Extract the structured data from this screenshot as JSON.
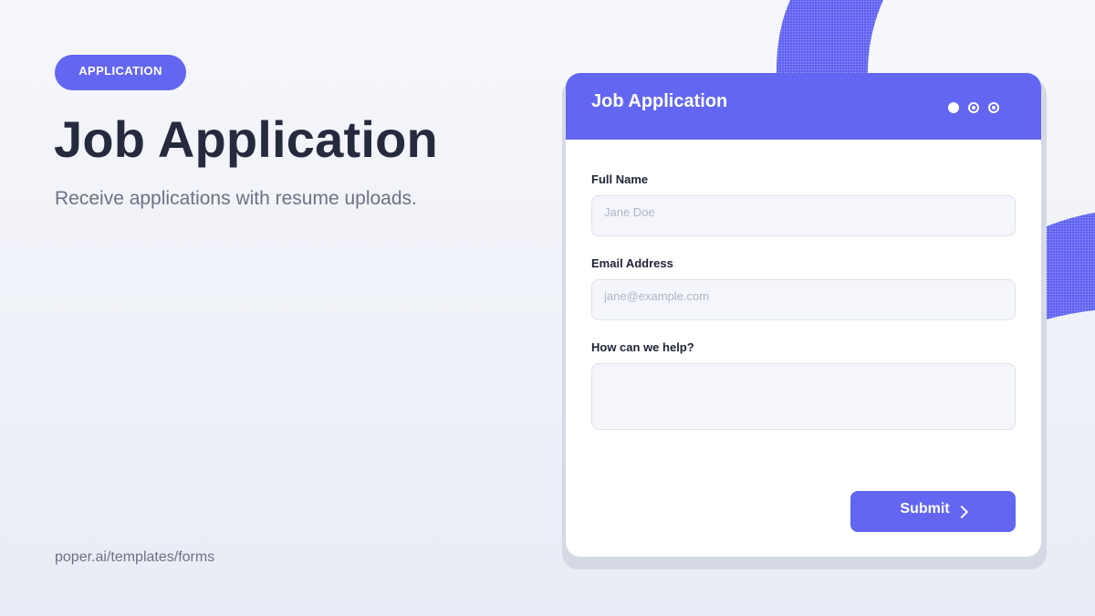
{
  "badge": "APPLICATION",
  "hero": {
    "title": "Job Application",
    "subtitle": "Receive applications with resume uploads."
  },
  "footer": {
    "link": "poper.ai/templates/forms"
  },
  "card": {
    "title": "Job Application",
    "window_dots": [
      "dot-filled-icon",
      "dot-ring-icon",
      "dot-ring-icon"
    ],
    "fields": {
      "full_name": {
        "label": "Full Name",
        "placeholder": "Jane Doe",
        "value": ""
      },
      "email": {
        "label": "Email Address",
        "placeholder": "jane@example.com",
        "value": ""
      },
      "message": {
        "label": "How can we help?",
        "placeholder": "",
        "value": ""
      }
    },
    "submit_label": "Submit"
  },
  "colors": {
    "accent": "#6366f1",
    "heading": "#262a3e",
    "muted_text": "#6b7285",
    "input_background": "#f5f6fb",
    "input_border": "#dfe2ec",
    "page_background": "#f1f3f9"
  }
}
